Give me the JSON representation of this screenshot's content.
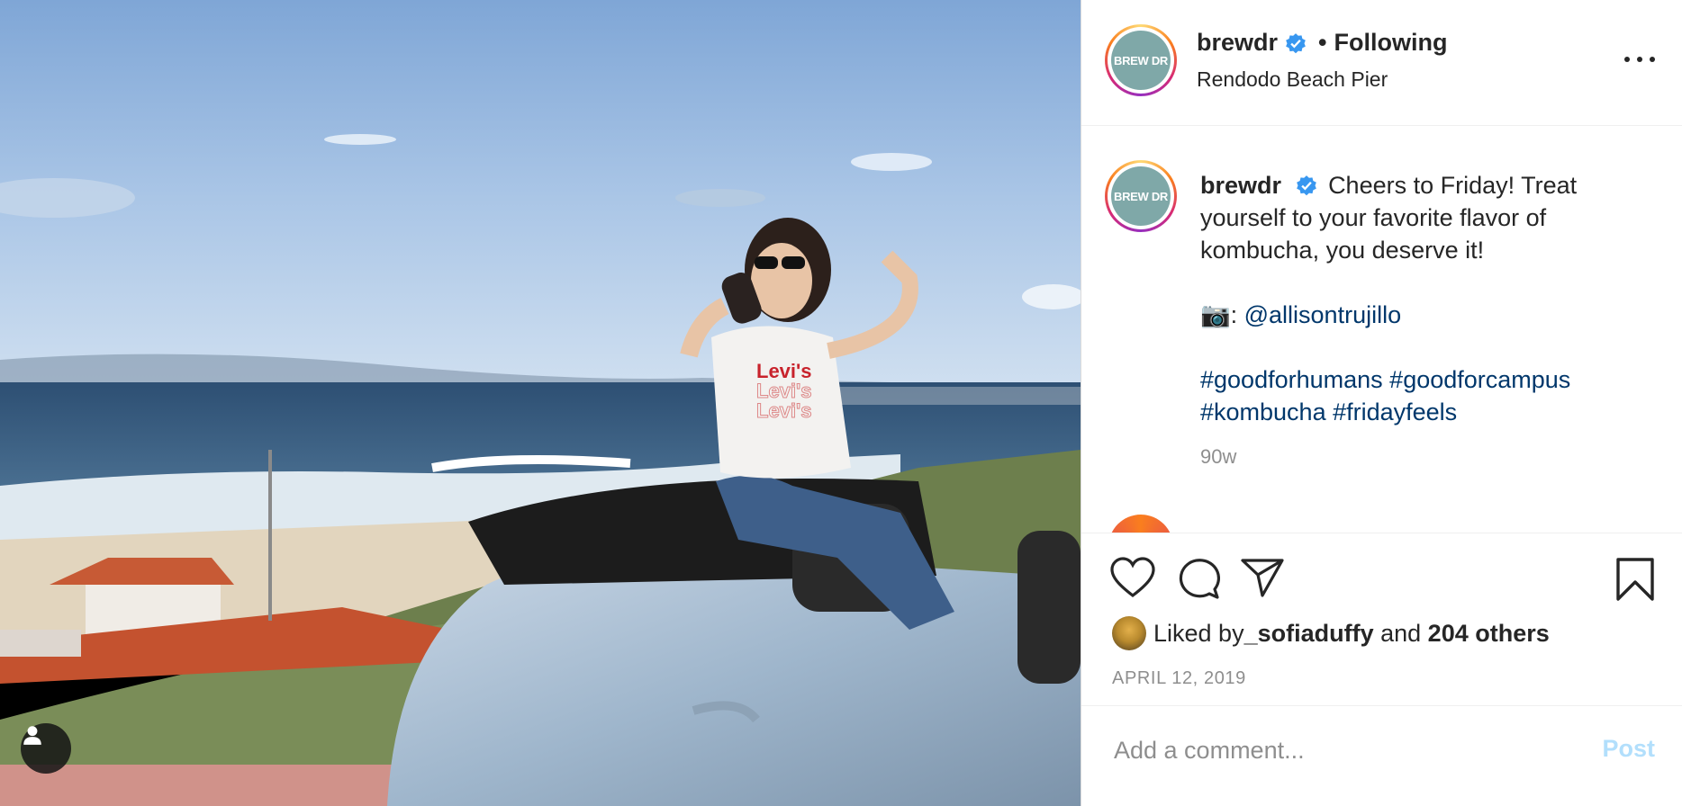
{
  "post": {
    "username": "brewdr",
    "verified_icon": "verified-badge-icon",
    "separator": "•",
    "follow_status": "Following",
    "location": "Rendodo Beach Pier",
    "avatar_text": "BREW DR",
    "caption_text": "Cheers to Friday! Treat yourself to your favorite flavor of kombucha, you deserve it!",
    "photo_credit_prefix": "📷: ",
    "photo_credit_handle": "@allisontrujillo",
    "hashtags": [
      "#goodforhumans",
      "#goodforcampus",
      "#kombucha",
      "#fridayfeels"
    ],
    "age": "90w",
    "likes_prefix": "Liked by ",
    "liked_by_user": "_sofiaduffy",
    "likes_and": " and ",
    "likes_others": "204 others",
    "date": "APRIL 12, 2019",
    "comment_placeholder": "Add a comment...",
    "post_button": "Post"
  },
  "icons": {
    "like": "heart-icon",
    "comment": "speech-bubble-icon",
    "share": "paper-plane-icon",
    "save": "bookmark-icon",
    "more": "more-options-icon",
    "tags": "user-tag-icon"
  },
  "colors": {
    "link": "#00376b",
    "muted": "#8e8e8e",
    "post_disabled": "#b2dffc",
    "verified": "#3897f0",
    "avatar_bg": "#7fa8a8"
  }
}
